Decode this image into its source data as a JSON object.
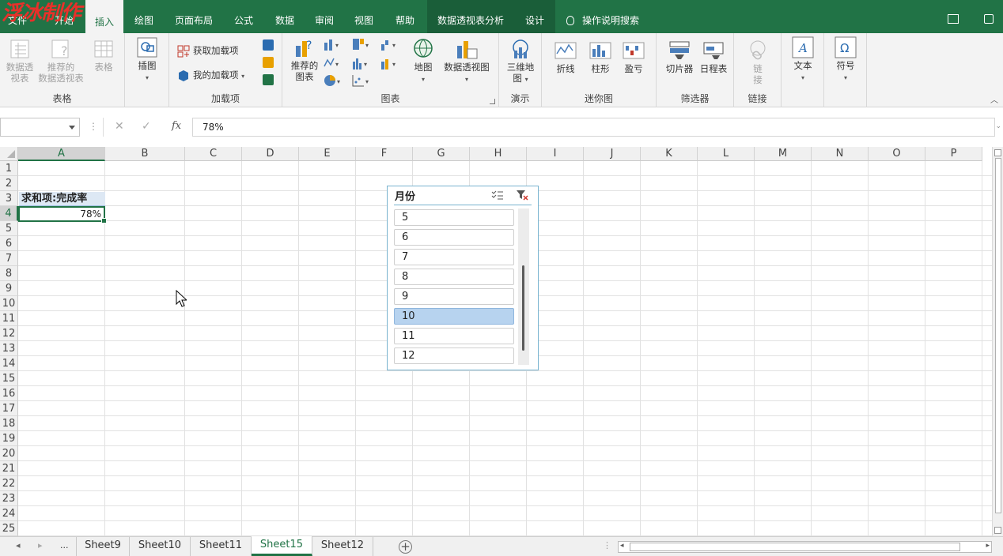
{
  "watermark": "浮冰制作",
  "ribbon_tabs": [
    {
      "label": "文件"
    },
    {
      "label": "开始"
    },
    {
      "label": "插入"
    },
    {
      "label": "绘图"
    },
    {
      "label": "页面布局"
    },
    {
      "label": "公式"
    },
    {
      "label": "数据"
    },
    {
      "label": "审阅"
    },
    {
      "label": "视图"
    },
    {
      "label": "帮助"
    },
    {
      "label": "数据透视表分析"
    },
    {
      "label": "设计"
    }
  ],
  "search": {
    "label": "操作说明搜索"
  },
  "groups": {
    "tables": {
      "label": "表格",
      "pivot": "数据透\n视表",
      "recommended_pivot": "推荐的\n数据透视表",
      "table": "表格"
    },
    "illustrations": {
      "insert_pic": "插图"
    },
    "addins": {
      "label": "加载项",
      "get": "获取加载项",
      "mine": "我的加载项"
    },
    "charts": {
      "label": "图表",
      "recommended": "推荐的\n图表",
      "map": "地图",
      "pivot_chart": "数据透视图"
    },
    "tours": {
      "label": "演示",
      "map3d": "三维地\n图"
    },
    "sparklines": {
      "label": "迷你图",
      "line": "折线",
      "column": "柱形",
      "winloss": "盈亏"
    },
    "filters": {
      "label": "筛选器",
      "slicer": "切片器",
      "timeline": "日程表"
    },
    "links": {
      "label": "链接",
      "link": "链\n接"
    },
    "text": {
      "label": "文本"
    },
    "symbols": {
      "label": "符号"
    }
  },
  "formula_bar": {
    "name_box": "",
    "fx": "fx",
    "value": "78%"
  },
  "columns": [
    "A",
    "B",
    "C",
    "D",
    "E",
    "F",
    "G",
    "H",
    "I",
    "J",
    "K",
    "L",
    "M",
    "N",
    "O",
    "P"
  ],
  "rows": [
    "1",
    "2",
    "3",
    "4",
    "5",
    "6",
    "7",
    "8",
    "9",
    "10",
    "11",
    "12",
    "13",
    "14",
    "15",
    "16",
    "17",
    "18",
    "19",
    "20",
    "21",
    "22",
    "23",
    "24",
    "25"
  ],
  "cells": {
    "A3": "求和项:完成率",
    "A4": "78%"
  },
  "slicer": {
    "title": "月份",
    "items": [
      {
        "label": "5",
        "selected": false
      },
      {
        "label": "6",
        "selected": false
      },
      {
        "label": "7",
        "selected": false
      },
      {
        "label": "8",
        "selected": false
      },
      {
        "label": "9",
        "selected": false
      },
      {
        "label": "10",
        "selected": true
      },
      {
        "label": "11",
        "selected": false
      },
      {
        "label": "12",
        "selected": false
      }
    ]
  },
  "sheets": {
    "overflow": "...",
    "tabs": [
      {
        "label": "Sheet9"
      },
      {
        "label": "Sheet10"
      },
      {
        "label": "Sheet11"
      },
      {
        "label": "Sheet15"
      },
      {
        "label": "Sheet12"
      }
    ],
    "active": "Sheet15"
  },
  "colors": {
    "accent": "#217346",
    "slicer_border": "#78b3cf",
    "slicer_selected": "#b7d3ef"
  }
}
